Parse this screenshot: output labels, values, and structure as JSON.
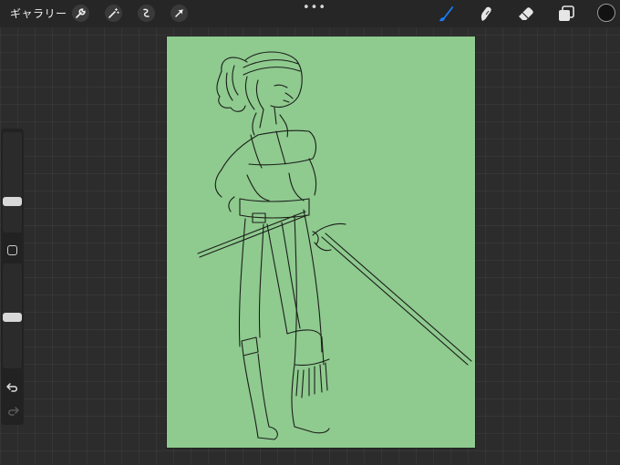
{
  "topbar": {
    "gallery_label": "ギャラリー",
    "more_label": "•••",
    "left_tools": [
      "wrench-icon",
      "magic-wand-icon",
      "selection-icon",
      "transform-arrow-icon"
    ],
    "right_tools": [
      "brush-icon",
      "smudge-icon",
      "eraser-icon",
      "layers-icon"
    ],
    "active_tool": "brush",
    "active_tool_color": "#1a7cf5",
    "current_color": "#121212"
  },
  "sidebar": {
    "brush_size_level": 0.29,
    "opacity_level": 0.49,
    "undo_icon": "undo-icon",
    "redo_icon": "redo-icon"
  },
  "canvas": {
    "background_color": "#8fca8f",
    "line_color": "#1a1f1a",
    "content": "line-art-character-sketch"
  }
}
